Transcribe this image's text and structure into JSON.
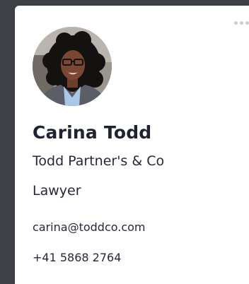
{
  "profile": {
    "name": "Carina Todd",
    "company": "Todd Partner's & Co",
    "role": "Lawyer",
    "email": "carina@toddco.com",
    "phone": "+41 5868 2764"
  },
  "icons": {
    "more": "more-horizontal-icon"
  },
  "colors": {
    "background": "#3d4045",
    "card": "#ffffff",
    "text": "#1f2230",
    "menu_dots": "#c9cbcf"
  }
}
